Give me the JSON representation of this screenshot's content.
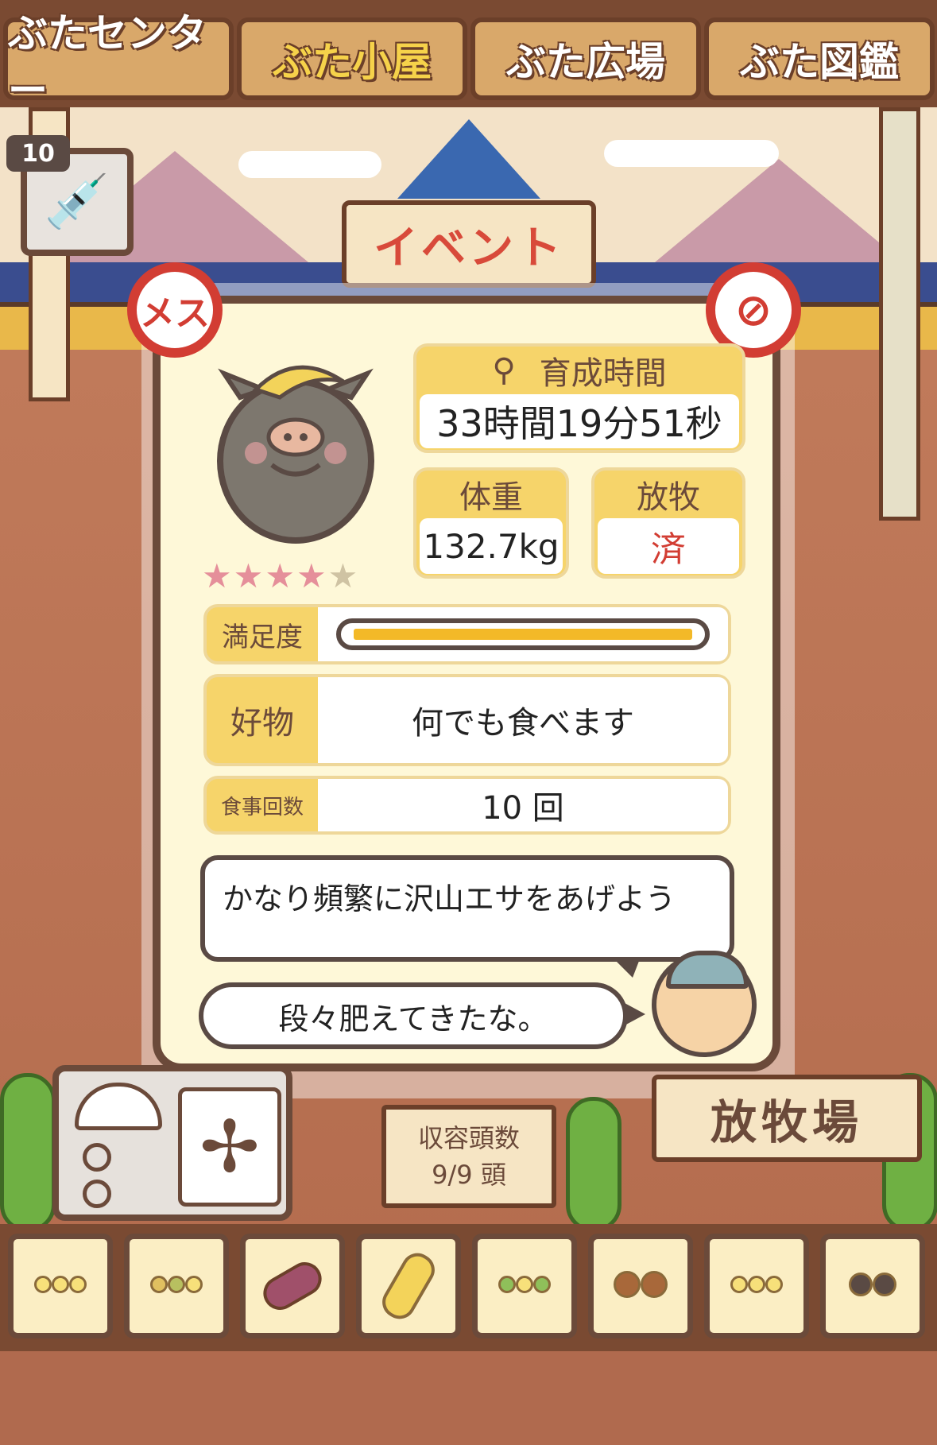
{
  "top_tabs": [
    {
      "label": "ぶたセンター"
    },
    {
      "label": "ぶた小屋"
    },
    {
      "label": "ぶた広場"
    },
    {
      "label": "ぶた図鑑"
    }
  ],
  "syringe": {
    "count": "10",
    "icon": "syringe-icon"
  },
  "event_sign": {
    "label": "イベント"
  },
  "pig_card": {
    "gender_badge": "メス",
    "stars": {
      "filled": 4,
      "total": 5
    },
    "growth_time": {
      "label": "育成時間",
      "value": "33時間19分51秒"
    },
    "weight": {
      "label": "体重",
      "value": "132.7kg"
    },
    "grazing": {
      "label": "放牧",
      "value": "済"
    },
    "satisfaction": {
      "label": "満足度",
      "level": 1.0
    },
    "favorite": {
      "label": "好物",
      "value": "何でも食べます"
    },
    "meals": {
      "label": "食事回数",
      "value": "10 回"
    },
    "advice": "かなり頻繁に沢山エサをあげよう",
    "farmer_comment": "段々肥えてきたな。"
  },
  "capacity_sign": {
    "label": "収容頭数",
    "value": "9/9 頭"
  },
  "pasture_sign": {
    "label": "放牧場"
  },
  "foods": [
    {
      "name": "soybeans-icon"
    },
    {
      "name": "mixed-grains-icon"
    },
    {
      "name": "sweet-potato-icon"
    },
    {
      "name": "corn-icon"
    },
    {
      "name": "herb-beans-icon"
    },
    {
      "name": "acorn-icon"
    },
    {
      "name": "plate-grains-icon"
    },
    {
      "name": "plate-meatballs-icon"
    }
  ],
  "colors": {
    "accent_yellow": "#f6d46a",
    "brown": "#6b4a3a",
    "red": "#d23d33"
  }
}
